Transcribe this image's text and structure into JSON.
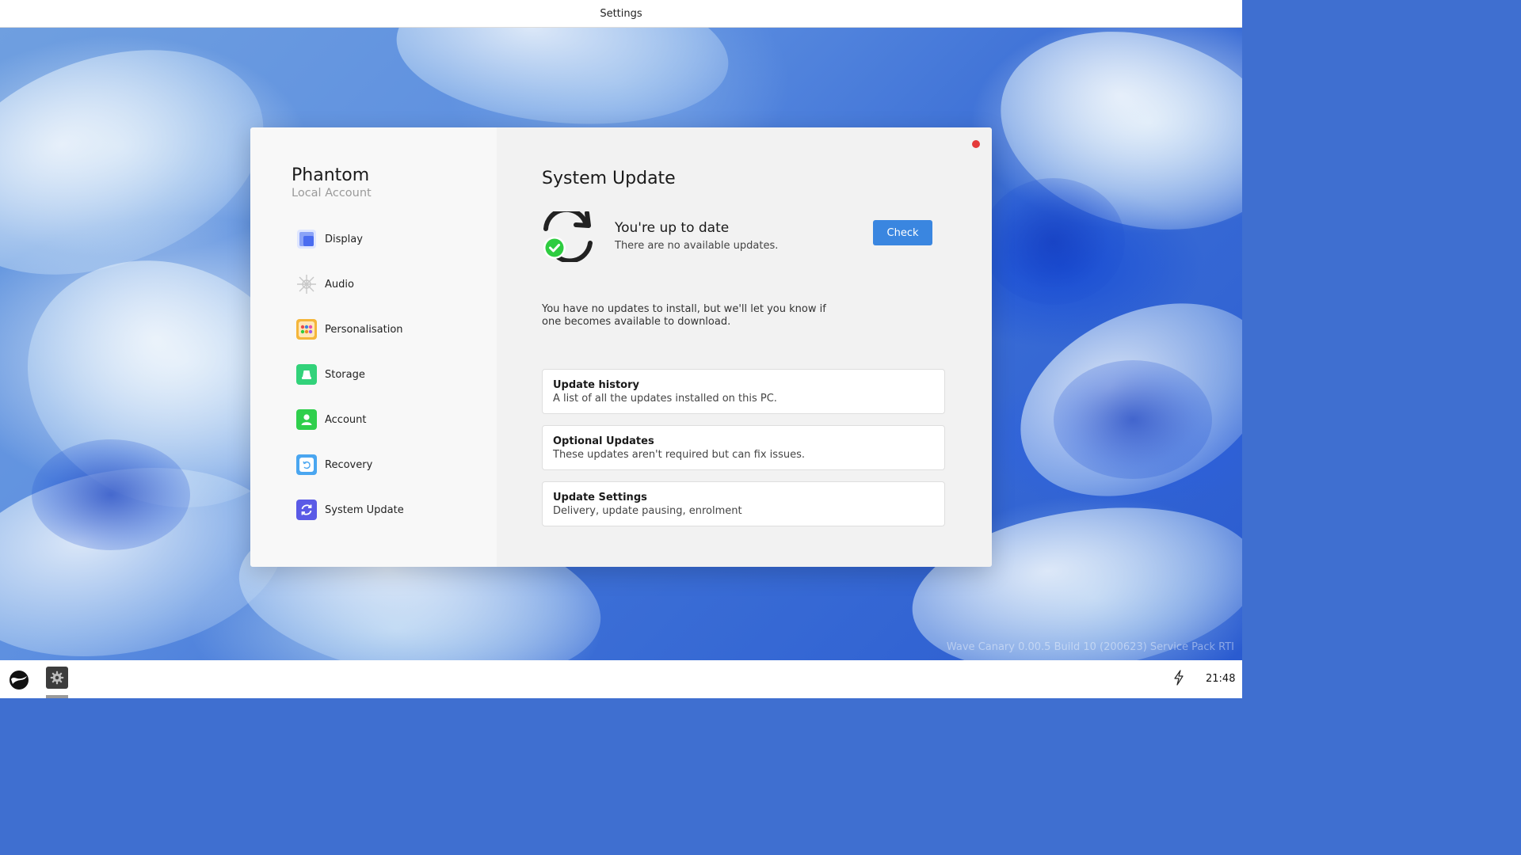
{
  "window_title": "Settings",
  "profile": {
    "name": "Phantom",
    "account_type": "Local Account"
  },
  "sidebar": {
    "items": [
      {
        "label": "Display",
        "icon": "display-icon",
        "color": "#4a6cf0"
      },
      {
        "label": "Audio",
        "icon": "audio-icon",
        "color": "#c8c8c8"
      },
      {
        "label": "Personalisation",
        "icon": "palette-icon",
        "color": "#f5b63a"
      },
      {
        "label": "Storage",
        "icon": "storage-icon",
        "color": "#32d27a"
      },
      {
        "label": "Account",
        "icon": "account-icon",
        "color": "#2fcf4c"
      },
      {
        "label": "Recovery",
        "icon": "recovery-icon",
        "color": "#4aa6f0"
      },
      {
        "label": "System Update",
        "icon": "sync-icon",
        "color": "#5a5ae6"
      }
    ]
  },
  "main": {
    "title": "System Update",
    "status_title": "You're up to date",
    "status_subtitle": "There are no available updates.",
    "check_button": "Check",
    "info_text": "You have no updates to install, but we'll let you know if one becomes available to download.",
    "cards": [
      {
        "title": "Update history",
        "subtitle": "A list of all the updates installed on this PC."
      },
      {
        "title": "Optional Updates",
        "subtitle": "These updates aren't required but can fix issues."
      },
      {
        "title": "Update Settings",
        "subtitle": "Delivery, update pausing, enrolment"
      }
    ]
  },
  "desktop": {
    "version_text": "Wave Canary 0.00.5 Build 10 (200623) Service Pack RTI"
  },
  "taskbar": {
    "clock": "21:48",
    "pinned_app": "gear-icon",
    "tray_icon": "bolt-icon"
  },
  "colors": {
    "accent": "#3a86e0",
    "close": "#e43a3a",
    "success": "#2ecc40"
  }
}
